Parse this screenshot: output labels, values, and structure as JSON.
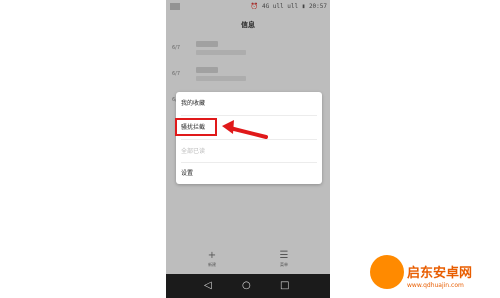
{
  "status_bar": {
    "time": "20:57",
    "indicators": "⏰ 4G ull ull ▮"
  },
  "header": {
    "title": "信息"
  },
  "messages": [
    {
      "date": "6/7"
    },
    {
      "date": "6/7"
    },
    {
      "date": "6/"
    },
    {
      "date": ""
    }
  ],
  "menu": {
    "items": [
      {
        "label": "我的收藏",
        "enabled": true
      },
      {
        "label": "骚扰拦截",
        "enabled": true,
        "highlighted": true
      },
      {
        "label": "全部已读",
        "enabled": false
      },
      {
        "label": "设置",
        "enabled": true
      }
    ]
  },
  "bottom_actions": [
    {
      "icon": "plus-icon",
      "label": "新建"
    },
    {
      "icon": "menu-icon",
      "label": "菜单"
    }
  ],
  "nav": {
    "back": "◁",
    "home": "○",
    "recents": "□"
  },
  "watermark": {
    "title": "启东安卓网",
    "url": "www.qdhuajin.com"
  },
  "colors": {
    "annotation": "#e0191a",
    "dim_overlay": "rgba(0,0,0,0.22)",
    "brand": "#e85d00"
  }
}
